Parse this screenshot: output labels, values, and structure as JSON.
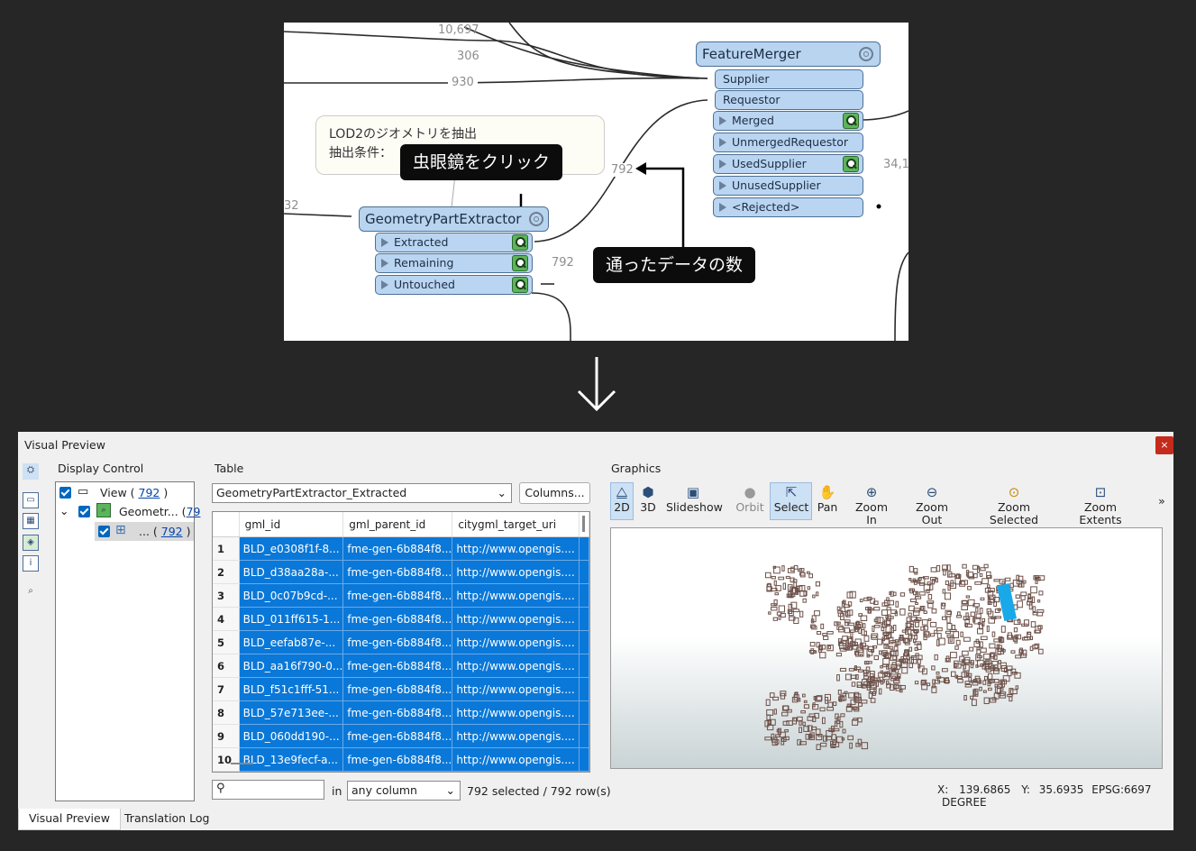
{
  "canvas": {
    "counts": {
      "c1": "10,697",
      "c2": "306",
      "c3": "930",
      "c4": "792",
      "c5": "792",
      "c6": "34,1",
      "c7": "32"
    },
    "note": {
      "line1": "LOD2のジオメトリを抽出",
      "line2": "抽出条件："
    },
    "feature_merger": {
      "title": "FeatureMerger",
      "inputs": [
        "Supplier",
        "Requestor"
      ],
      "outputs": [
        "Merged",
        "UnmergedRequestor",
        "UsedSupplier",
        "UnusedSupplier",
        "<Rejected>"
      ]
    },
    "geometry_part_extractor": {
      "title": "GeometryPartExtractor",
      "outputs": [
        "Extracted",
        "Remaining",
        "Untouched"
      ]
    },
    "callouts": {
      "click": "虫眼鏡をクリック",
      "count": "通ったデータの数"
    }
  },
  "visual_preview": {
    "title": "Visual Preview",
    "close": "×",
    "display_control": {
      "label": "Display Control",
      "view_label": "View (",
      "view_count": "792",
      "view_suffix": ")",
      "node_label": "Geometr... (",
      "node_count": "79",
      "child_label": "... (",
      "child_count": "792",
      "child_suffix": ")"
    },
    "table": {
      "label": "Table",
      "selected_table": "GeometryPartExtractor_Extracted",
      "columns_button": "Columns...",
      "headers": [
        "gml_id",
        "gml_parent_id",
        "citygml_target_uri"
      ],
      "rows": [
        [
          "1",
          "BLD_e0308f1f-8...",
          "fme-gen-6b884f8...",
          "http://www.opengis...."
        ],
        [
          "2",
          "BLD_d38aa28a-...",
          "fme-gen-6b884f8...",
          "http://www.opengis...."
        ],
        [
          "3",
          "BLD_0c07b9cd-...",
          "fme-gen-6b884f8...",
          "http://www.opengis...."
        ],
        [
          "4",
          "BLD_011ff615-1...",
          "fme-gen-6b884f8...",
          "http://www.opengis...."
        ],
        [
          "5",
          "BLD_eefab87e-...",
          "fme-gen-6b884f8...",
          "http://www.opengis...."
        ],
        [
          "6",
          "BLD_aa16f790-0...",
          "fme-gen-6b884f8...",
          "http://www.opengis...."
        ],
        [
          "7",
          "BLD_f51c1fff-51...",
          "fme-gen-6b884f8...",
          "http://www.opengis...."
        ],
        [
          "8",
          "BLD_57e713ee-...",
          "fme-gen-6b884f8...",
          "http://www.opengis...."
        ],
        [
          "9",
          "BLD_060dd190-...",
          "fme-gen-6b884f8...",
          "http://www.opengis...."
        ],
        [
          "10",
          "BLD_13e9fecf-a...",
          "fme-gen-6b884f8...",
          "http://www.opengis...."
        ]
      ],
      "search_in": "in",
      "column_select": "any column",
      "status": "792 selected / 792 row(s)"
    },
    "graphics": {
      "label": "Graphics",
      "toolbar": [
        "2D",
        "3D",
        "Slideshow",
        "Orbit",
        "Select",
        "Pan",
        "Zoom In",
        "Zoom Out",
        "Zoom Selected",
        "Zoom Extents"
      ],
      "more": "»",
      "coords": {
        "x_label": "X:",
        "x": "139.6865",
        "y_label": "Y:",
        "y": "35.6935",
        "epsg": "EPSG:6697",
        "unit": "DEGREE"
      }
    },
    "tabs": [
      "Visual Preview",
      "Translation Log"
    ],
    "colors": {
      "selection": "#0a78d8",
      "buildings": "#6d5149",
      "highlight": "#19a9e8"
    }
  }
}
